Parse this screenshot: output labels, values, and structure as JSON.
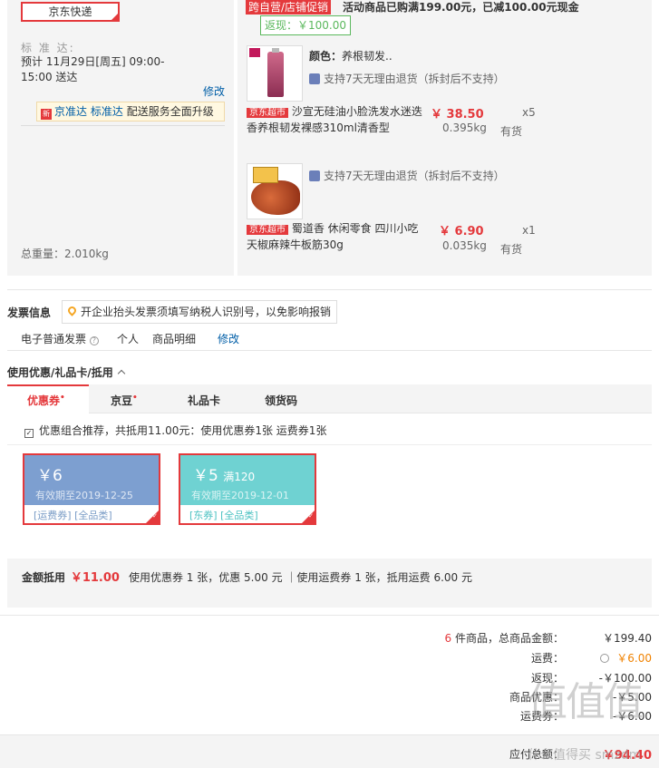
{
  "shipping": {
    "express": "京东快递",
    "std_label": "标 准 达:",
    "std_time": "预计 11月29日[周五] 09:00-15:00 送达",
    "modify": "修改",
    "jzd_text1": "京准达",
    "jzd_text2": "标准达",
    "jzd_text3": "配送服务全面升级",
    "total_weight": "总重量：2.010kg"
  },
  "promo": {
    "tag": "跨自营/店铺促销",
    "text": "活动商品已购满199.00元，已减100.00元现金",
    "cashback": "返现：￥100.00"
  },
  "products": [
    {
      "color_label": "颜色：",
      "color_value": "养根韧发..",
      "return": "支持7天无理由退货（拆封后不支持）",
      "tag": "京东超市",
      "title": "沙宣无硅油小脸洗发水迷迭香养根韧发裸感310ml清香型",
      "price": "￥ 38.50",
      "weight": "0.395kg",
      "qty": "x5",
      "stock": "有货"
    },
    {
      "return": "支持7天无理由退货（拆封后不支持）",
      "tag": "京东超市",
      "title": "蜀道香 休闲零食 四川小吃 天椒麻辣牛板筋30g",
      "price": "￥ 6.90",
      "weight": "0.035kg",
      "qty": "x1",
      "stock": "有货"
    }
  ],
  "invoice": {
    "title": "发票信息",
    "tip": "开企业抬头发票须填写纳税人识别号，以免影响报销",
    "type": "电子普通发票",
    "person": "个人",
    "detail": "商品明细",
    "modify": "修改"
  },
  "coupons": {
    "title": "使用优惠/礼品卡/抵用",
    "tabs": [
      "优惠券",
      "京豆",
      "礼品卡",
      "领货码"
    ],
    "tab_star": "•",
    "combo": "优惠组合推荐，共抵用11.00元：使用优惠券1张 运费券1张",
    "cards": [
      {
        "amount": "￥6",
        "cond": "",
        "valid": "有效期至2019-12-25",
        "types": "[运费券] [全品类]"
      },
      {
        "amount": "￥5",
        "cond": "满120",
        "valid": "有效期至2019-12-01",
        "types": "[东券] [全品类]"
      }
    ],
    "deduct_label": "金额抵用",
    "deduct_amount": "￥11.00",
    "deduct_detail": "使用优惠券 1 张，优惠 5.00 元 ｜使用运费券 1 张，抵用运费 6.00 元"
  },
  "summary": {
    "items_count": "6",
    "items_label": "件商品，总商品金额：",
    "items_total": "￥199.40",
    "freight_label": "运费：",
    "freight": "￥6.00",
    "cashback_label": "返现：",
    "cashback": "-￥100.00",
    "discount_label": "商品优惠：",
    "discount": "-￥5.00",
    "freight_coupon_label": "运费券：",
    "freight_coupon": "-￥6.00",
    "pay_label": "应付总额：",
    "pay": "￥94.40"
  },
  "watermark": {
    "logo": "值值值",
    "site": "什么值得买 smzdm"
  },
  "colors": {
    "accent": "#e4393c",
    "link": "#005ea7",
    "panel": "#f4f4f4",
    "coupon1": "#7d9fd0",
    "coupon2": "#6fd2d2"
  }
}
